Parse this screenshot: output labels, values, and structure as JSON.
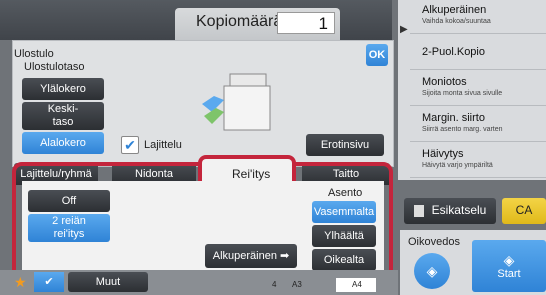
{
  "header": {
    "copies_label": "Kopiomäärä",
    "copies_value": "1"
  },
  "output": {
    "title": "Ulostulo",
    "tray_title": "Ulostulotaso",
    "trays": [
      "Ylälokero",
      "Keski-\ntaso",
      "Alalokero"
    ],
    "sort_label": "Lajittelu",
    "ok": "OK",
    "separator": "Erotinsivu"
  },
  "tabs": [
    "Lajittelu/ryhmä",
    "Nidonta",
    "Rei'itys",
    "Taitto"
  ],
  "punch": {
    "off": "Off",
    "two_hole": "2 reiän\nrei'itys",
    "position_title": "Asento",
    "positions": [
      "Vasemmalta",
      "Ylhäältä",
      "Oikealta"
    ],
    "original": "Alkuperäinen"
  },
  "right_menu": [
    {
      "title": "Alkuperäinen",
      "sub": "Vaihda kokoa/suuntaa"
    },
    {
      "title": "2-Puol.Kopio",
      "sub": ""
    },
    {
      "title": "Moniotos",
      "sub": "Sijoita monta sivua sivulle"
    },
    {
      "title": "Margin. siirto",
      "sub": "Siirrä asento marg. varten"
    },
    {
      "title": "Häivytys",
      "sub": "Häivytä varjo ympäriltä"
    }
  ],
  "actions": {
    "preview": "Esikatselu",
    "ca": "CA",
    "color_label": "Oikovedos",
    "start": "Start"
  },
  "footer": {
    "more": "Muut",
    "paper_a3": "A3",
    "paper_a4": "A4",
    "num4": "4"
  },
  "colors": {
    "accent": "#2f83d6",
    "highlight": "#c4253c",
    "ca": "#e9c31f"
  }
}
